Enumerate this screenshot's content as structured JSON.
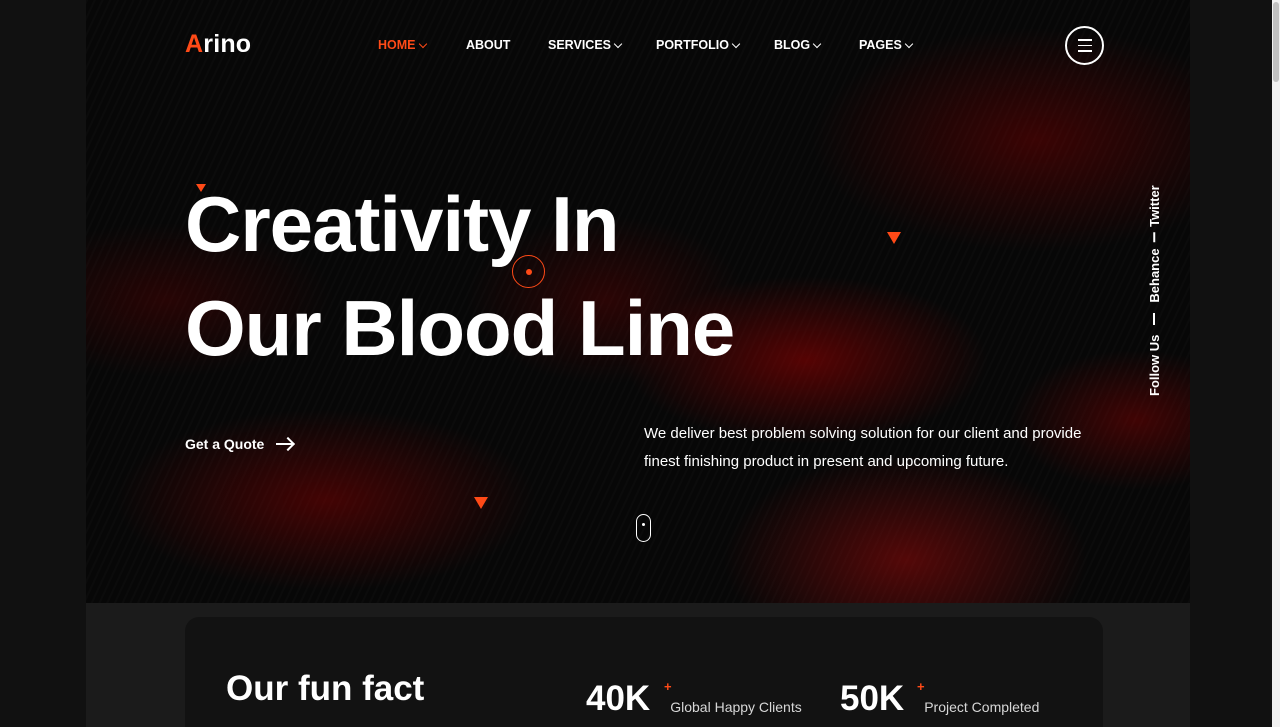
{
  "brand": {
    "logo_first": "A",
    "logo_rest": "rino",
    "accent": "#ff4a17"
  },
  "nav": {
    "items": [
      {
        "label": "HOME",
        "active": true,
        "dropdown": true
      },
      {
        "label": "ABOUT",
        "active": false,
        "dropdown": false
      },
      {
        "label": "SERVICES",
        "active": false,
        "dropdown": true
      },
      {
        "label": "PORTFOLIO",
        "active": false,
        "dropdown": true
      },
      {
        "label": "BLOG",
        "active": false,
        "dropdown": true
      },
      {
        "label": "PAGES",
        "active": false,
        "dropdown": true
      }
    ],
    "menu_icon": "hamburger-icon"
  },
  "hero": {
    "title_line1": "Creativity In",
    "title_line2": "Our Blood Line",
    "cta": "Get a Quote",
    "lead": "We deliver best problem solving solution for our client and provide finest finishing product in present and upcoming future."
  },
  "social": {
    "follow": "Follow Us",
    "links": [
      "Behance",
      "Twitter"
    ]
  },
  "funfact": {
    "title": "Our fun fact",
    "stats": [
      {
        "value": "40K",
        "plus": "+",
        "label": "Global Happy Clients"
      },
      {
        "value": "50K",
        "plus": "+",
        "label": "Project Completed"
      }
    ]
  }
}
